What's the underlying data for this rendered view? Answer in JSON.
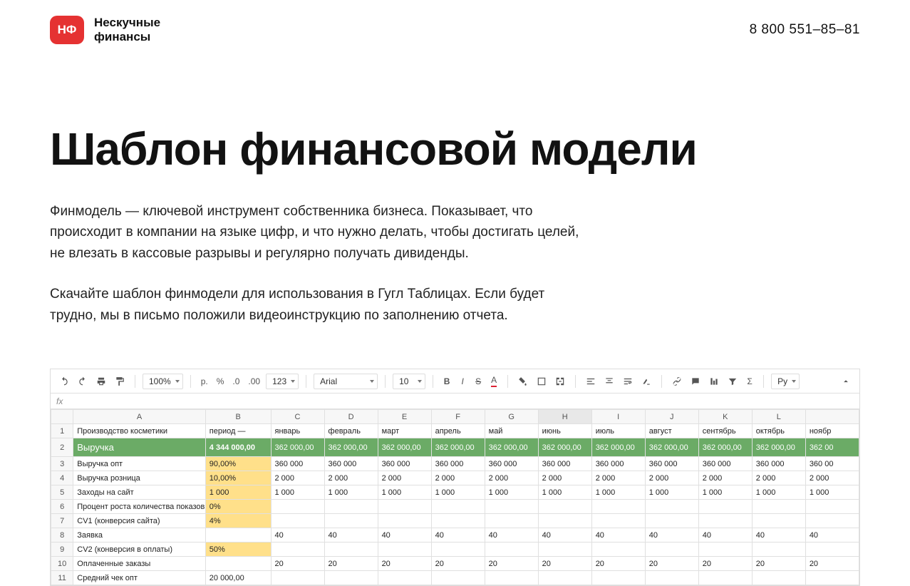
{
  "header": {
    "logo_text": "НФ",
    "brand_line1": "Нескучные",
    "brand_line2": "финансы",
    "phone": "8 800 551–85–81"
  },
  "page": {
    "title": "Шаблон финансовой модели",
    "para1": "Финмодель — ключевой инструмент собственника бизнеса. Показывает, что происходит в компании на языке цифр, и что нужно делать, чтобы достигать целей, не влезать в кассовые разрывы и регулярно получать дивиденды.",
    "para2": "Скачайте шаблон финмодели для использования в Гугл Таблицах. Если будет трудно, мы в письмо положили видеоинструкцию по заполнению отчета."
  },
  "sheet": {
    "toolbar": {
      "zoom": "100%",
      "currency": "р.",
      "percent": "%",
      "dec_dec": ".0",
      "dec_inc": ".00",
      "num_fmt": "123",
      "font": "Arial",
      "font_size": "10",
      "script": "Ру"
    },
    "fx": "fx",
    "col_letters": [
      "",
      "A",
      "B",
      "C",
      "D",
      "E",
      "F",
      "G",
      "H",
      "I",
      "J",
      "K",
      "L",
      ""
    ],
    "months": [
      "январь",
      "февраль",
      "март",
      "апрель",
      "май",
      "июнь",
      "июль",
      "август",
      "сентябрь",
      "октябрь",
      "ноябр"
    ],
    "rows": [
      {
        "n": "1",
        "a": "Производство косметики",
        "b": "период —",
        "vals": [
          "январь",
          "февраль",
          "март",
          "апрель",
          "май",
          "июнь",
          "июль",
          "август",
          "сентябрь",
          "октябрь",
          "ноябр"
        ],
        "cls": ""
      },
      {
        "n": "2",
        "a": "Выручка",
        "b": "4 344 000,00",
        "vals": [
          "362 000,00",
          "362 000,00",
          "362 000,00",
          "362 000,00",
          "362 000,00",
          "362 000,00",
          "362 000,00",
          "362 000,00",
          "362 000,00",
          "362 000,00",
          "362 00"
        ],
        "cls": "revenue-row"
      },
      {
        "n": "3",
        "a": "Выручка опт",
        "b": "90,00%",
        "b_cls": "yellow",
        "vals": [
          "360 000",
          "360 000",
          "360 000",
          "360 000",
          "360 000",
          "360 000",
          "360 000",
          "360 000",
          "360 000",
          "360 000",
          "360 00"
        ]
      },
      {
        "n": "4",
        "a": "Выручка розница",
        "b": "10,00%",
        "b_cls": "yellow",
        "vals": [
          "2 000",
          "2 000",
          "2 000",
          "2 000",
          "2 000",
          "2 000",
          "2 000",
          "2 000",
          "2 000",
          "2 000",
          "2 000"
        ]
      },
      {
        "n": "5",
        "a": "Заходы на сайт",
        "b": "1 000",
        "b_cls": "yellow",
        "vals": [
          "1 000",
          "1 000",
          "1 000",
          "1 000",
          "1 000",
          "1 000",
          "1 000",
          "1 000",
          "1 000",
          "1 000",
          "1 000"
        ]
      },
      {
        "n": "6",
        "a": "Процент роста количества показов",
        "b": "0%",
        "b_cls": "yellow",
        "vals": [
          "",
          "",
          "",
          "",
          "",
          "",
          "",
          "",
          "",
          "",
          ""
        ]
      },
      {
        "n": "7",
        "a": "CV1 (конверсия сайта)",
        "b": "4%",
        "b_cls": "yellow",
        "vals": [
          "",
          "",
          "",
          "",
          "",
          "",
          "",
          "",
          "",
          "",
          ""
        ]
      },
      {
        "n": "8",
        "a": "Заявка",
        "b": "",
        "vals": [
          "40",
          "40",
          "40",
          "40",
          "40",
          "40",
          "40",
          "40",
          "40",
          "40",
          "40"
        ]
      },
      {
        "n": "9",
        "a": "CV2 (конверсия в оплаты)",
        "b": "50%",
        "b_cls": "yellow",
        "vals": [
          "",
          "",
          "",
          "",
          "",
          "",
          "",
          "",
          "",
          "",
          ""
        ]
      },
      {
        "n": "10",
        "a": "Оплаченные заказы",
        "b": "",
        "vals": [
          "20",
          "20",
          "20",
          "20",
          "20",
          "20",
          "20",
          "20",
          "20",
          "20",
          "20"
        ]
      },
      {
        "n": "11",
        "a": "Средний чек опт",
        "b": "20 000,00",
        "vals": [
          "",
          "",
          "",
          "",
          "",
          "",
          "",
          "",
          "",
          "",
          ""
        ]
      }
    ]
  }
}
